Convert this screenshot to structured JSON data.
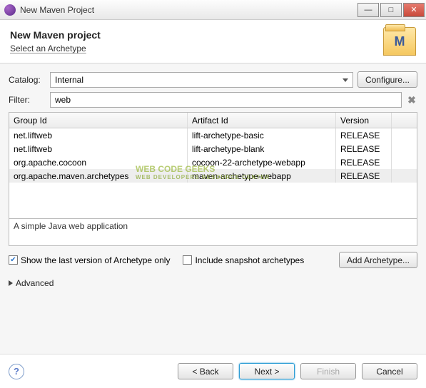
{
  "window": {
    "title": "New Maven Project"
  },
  "header": {
    "title": "New Maven project",
    "subtitle": "Select an Archetype"
  },
  "catalog": {
    "label": "Catalog:",
    "value": "Internal",
    "configure": "Configure..."
  },
  "filter": {
    "label": "Filter:",
    "value": "web"
  },
  "table": {
    "headers": {
      "group": "Group Id",
      "artifact": "Artifact Id",
      "version": "Version"
    },
    "rows": [
      {
        "group": "net.liftweb",
        "artifact": "lift-archetype-basic",
        "version": "RELEASE",
        "selected": false
      },
      {
        "group": "net.liftweb",
        "artifact": "lift-archetype-blank",
        "version": "RELEASE",
        "selected": false
      },
      {
        "group": "org.apache.cocoon",
        "artifact": "cocoon-22-archetype-webapp",
        "version": "RELEASE",
        "selected": false
      },
      {
        "group": "org.apache.maven.archetypes",
        "artifact": "maven-archetype-webapp",
        "version": "RELEASE",
        "selected": true
      }
    ]
  },
  "description": "A simple Java web application",
  "options": {
    "show_last": "Show the last version of Archetype only",
    "include_snapshot": "Include snapshot archetypes",
    "add_archetype": "Add Archetype..."
  },
  "advanced": "Advanced",
  "buttons": {
    "back": "< Back",
    "next": "Next >",
    "finish": "Finish",
    "cancel": "Cancel"
  },
  "watermark": {
    "main": "WEB CODE GEEKS",
    "sub": "WEB DEVELOPERS RESOURCE CENTER"
  }
}
